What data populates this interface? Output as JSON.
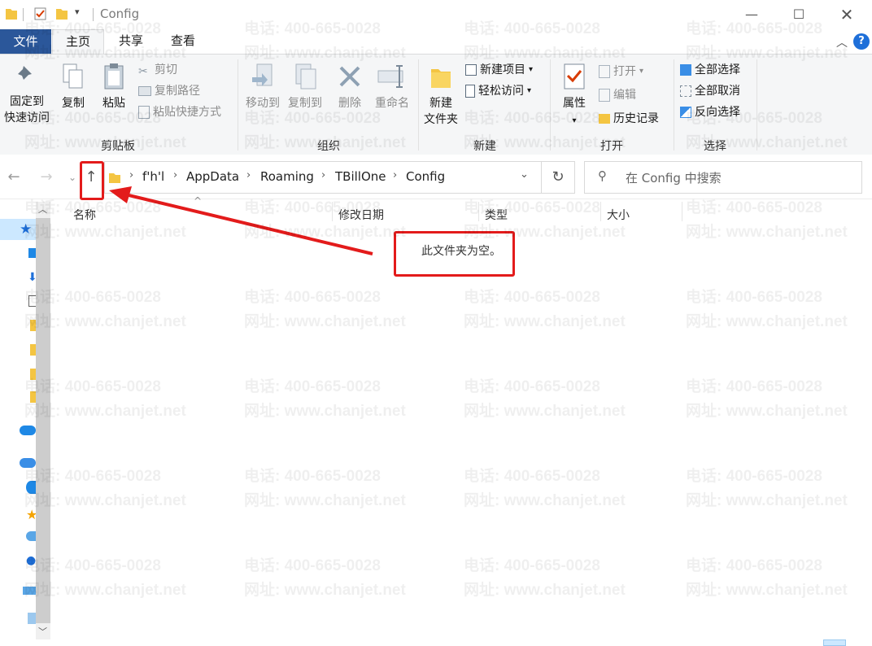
{
  "window": {
    "title": "Config",
    "minimize_icon": "minimize-icon",
    "maximize_icon": "maximize-icon",
    "close_icon": "close-icon"
  },
  "tabs": {
    "file": "文件",
    "home": "主页",
    "share": "共享",
    "view": "查看"
  },
  "ribbon": {
    "clipboard": {
      "label": "剪贴板",
      "pin": "固定到",
      "pin2": "快速访问",
      "copy": "复制",
      "paste": "粘贴",
      "cut": "剪切",
      "copy_path": "复制路径",
      "paste_shortcut": "粘贴快捷方式"
    },
    "organize": {
      "label": "组织",
      "move_to": "移动到",
      "copy_to": "复制到",
      "delete": "删除",
      "rename": "重命名"
    },
    "new": {
      "label": "新建",
      "new_folder": "新建",
      "new_folder2": "文件夹",
      "new_item": "新建项目",
      "easy_access": "轻松访问"
    },
    "open": {
      "label": "打开",
      "properties": "属性",
      "open": "打开",
      "edit": "编辑",
      "history": "历史记录"
    },
    "select": {
      "label": "选择",
      "select_all": "全部选择",
      "select_none": "全部取消",
      "invert": "反向选择"
    }
  },
  "address": {
    "crumbs": [
      "f'h'l",
      "AppData",
      "Roaming",
      "TBillOne",
      "Config"
    ],
    "search_placeholder": "在 Config 中搜索"
  },
  "columns": {
    "name": "名称",
    "modified": "修改日期",
    "type": "类型",
    "size": "大小"
  },
  "content": {
    "empty_message": "此文件夹为空。"
  },
  "watermark": {
    "phone": "电话: 400-665-0028",
    "site": "网址: www.chanjet.net"
  },
  "colors": {
    "file_tab": "#2b579a",
    "annotation_red": "#e31b1b",
    "folder_yellow": "#f4c542"
  }
}
